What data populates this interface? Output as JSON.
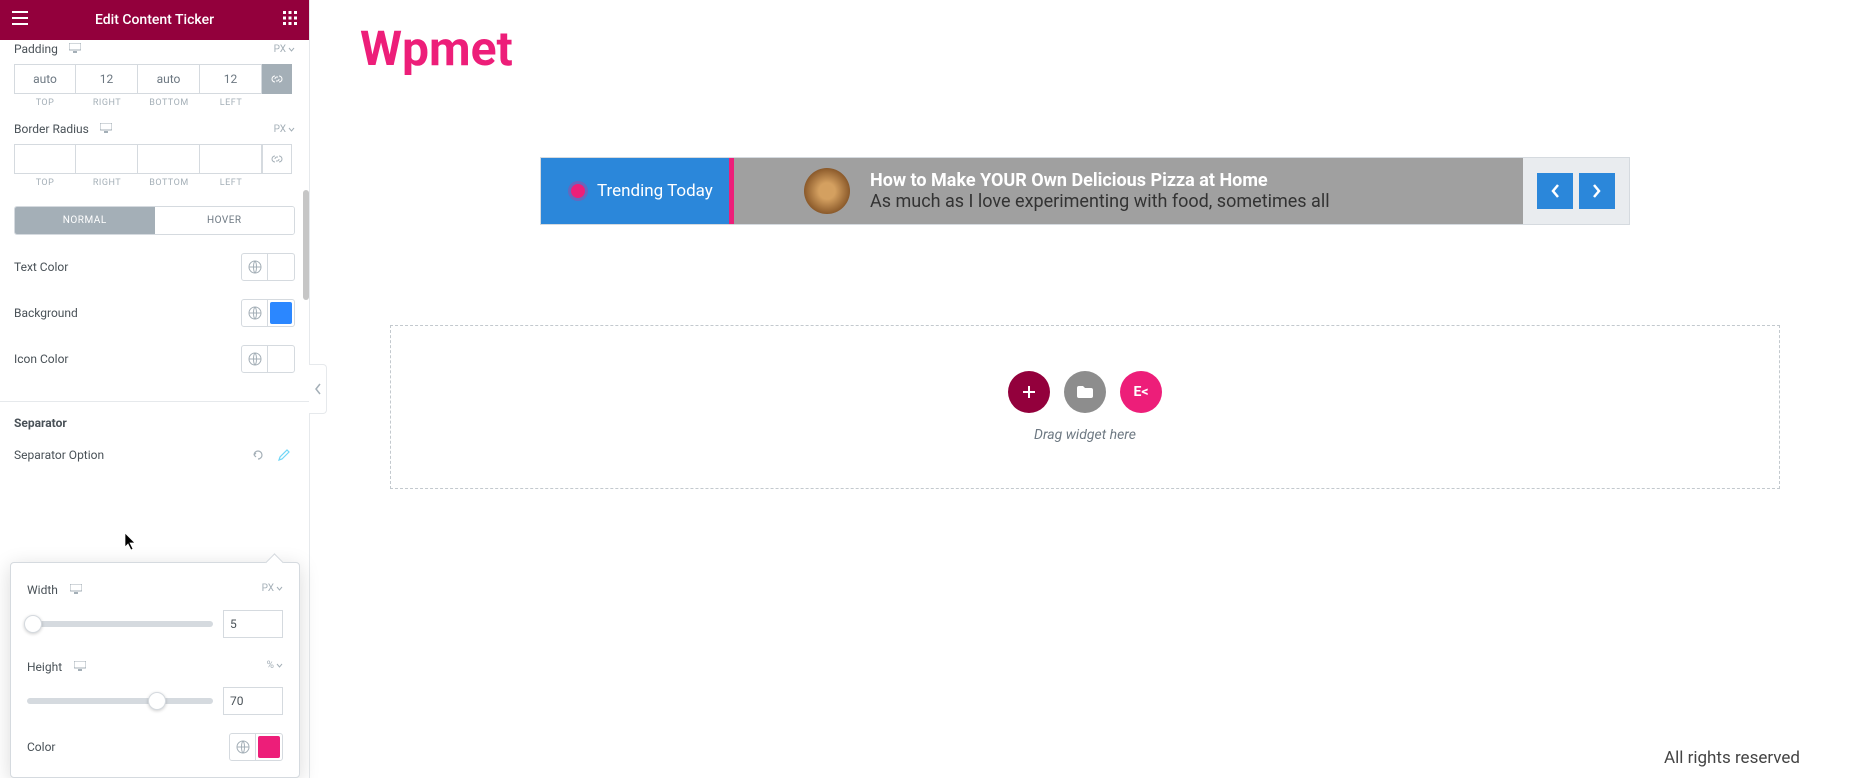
{
  "header": {
    "title": "Edit Content Ticker"
  },
  "panel": {
    "padding": {
      "label": "Padding",
      "unit": "PX",
      "top": "auto",
      "right": "12",
      "bottom": "auto",
      "left": "12",
      "labels": {
        "t": "TOP",
        "r": "RIGHT",
        "b": "BOTTOM",
        "l": "LEFT"
      }
    },
    "border_radius": {
      "label": "Border Radius",
      "unit": "PX",
      "top": "",
      "right": "",
      "bottom": "",
      "left": "",
      "labels": {
        "t": "TOP",
        "r": "RIGHT",
        "b": "BOTTOM",
        "l": "LEFT"
      }
    },
    "tabs": {
      "normal": "NORMAL",
      "hover": "HOVER"
    },
    "text_color": {
      "label": "Text Color"
    },
    "background": {
      "label": "Background",
      "color": "#2b87ff"
    },
    "icon_color": {
      "label": "Icon Color"
    },
    "separator_section": "Separator",
    "separator_option": {
      "label": "Separator Option"
    }
  },
  "popover": {
    "width": {
      "label": "Width",
      "unit": "PX",
      "value": "5",
      "percent": 3
    },
    "height": {
      "label": "Height",
      "unit": "%",
      "value": "70",
      "percent": 70
    },
    "color": {
      "label": "Color",
      "value": "#ed1e79"
    }
  },
  "main": {
    "brand": "Wpmet",
    "ticker": {
      "badge": "Trending Today",
      "title": "How to Make YOUR Own Delicious Pizza at Home",
      "subtitle": "As much as I love experimenting with food, sometimes all"
    },
    "drop": {
      "hint": "Drag widget here",
      "ek": "E<"
    },
    "footer": "All rights reserved"
  }
}
